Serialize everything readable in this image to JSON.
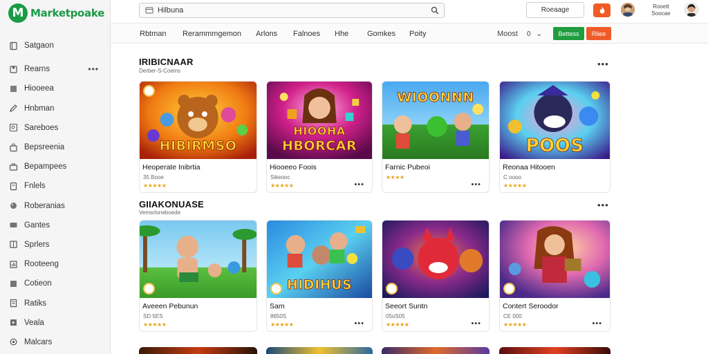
{
  "app": {
    "name": "Marketpoake",
    "logo_letter": "M"
  },
  "sidebar": {
    "items": [
      {
        "label": "Satgaon",
        "icon": "book-icon"
      },
      {
        "label": "Rearns",
        "icon": "bookmark-icon",
        "more": "•••"
      },
      {
        "label": "Hiooeea",
        "icon": "grid-icon"
      },
      {
        "label": "Hnbman",
        "icon": "pencil-icon"
      },
      {
        "label": "Sareboes",
        "icon": "search-icon"
      },
      {
        "label": "Bepsreenia",
        "icon": "bag-icon"
      },
      {
        "label": "Bepampees",
        "icon": "briefcase-icon"
      },
      {
        "label": "Fnlels",
        "icon": "file-icon"
      },
      {
        "label": "Roberanias",
        "icon": "palette-icon"
      },
      {
        "label": "Gantes",
        "icon": "gamepad-icon"
      },
      {
        "label": "Sprlers",
        "icon": "columns-icon"
      },
      {
        "label": "Rooteeng",
        "icon": "chart-icon"
      },
      {
        "label": "Cotieon",
        "icon": "image-icon"
      },
      {
        "label": "Ratiks",
        "icon": "doc-icon"
      },
      {
        "label": "Veala",
        "icon": "video-icon"
      },
      {
        "label": "Malcars",
        "icon": "settings-icon"
      }
    ]
  },
  "header": {
    "search_value": "Hilbuna",
    "button_label": "Roeaage",
    "user_name": "Rooett",
    "user_sub": "Soocae"
  },
  "tabs": [
    {
      "label": "Rbtman"
    },
    {
      "label": "Rerammmgemon"
    },
    {
      "label": "Arlons"
    },
    {
      "label": "Falnoes"
    },
    {
      "label": "Hhe"
    },
    {
      "label": "Gomkes"
    },
    {
      "label": "Poity"
    }
  ],
  "toolbar": {
    "model_label": "Moost",
    "filter_icon_label": "0",
    "green_label": "Bettess",
    "red_label": "Rliee"
  },
  "sections": [
    {
      "title": "IRIBICNAAR",
      "subtitle": "Derber-S-Coeins",
      "more": "•••",
      "cards": [
        {
          "name": "Heoperate Inibrtia",
          "meta": "35 Booe",
          "stars": "★★★★★",
          "thumb_title": "HIBIRMSO",
          "dots": ""
        },
        {
          "name": "Hiooeeo Foois",
          "meta": "Sikeooc",
          "stars": "★★★★★",
          "thumb_title": "HBORCAR",
          "thumb_title2": "HIOOHA",
          "dots": "•••"
        },
        {
          "name": "Farnic Pubeoi",
          "meta": "",
          "stars": "★★★★",
          "thumb_title": "WIOONNN",
          "dots": "•••"
        },
        {
          "name": "Reonaa Hitooen",
          "meta": "C oooo",
          "stars": "★★★★★",
          "thumb_title": "POOS",
          "dots": ""
        }
      ]
    },
    {
      "title": "GIIAKONUASE",
      "subtitle": "Vemsrloneboede",
      "more": "•••",
      "cards": [
        {
          "name": "Aveeen Pebunun",
          "meta": "SD 5ES",
          "stars": "★★★★★",
          "thumb_title": "",
          "dots": ""
        },
        {
          "name": "Sam",
          "meta": "8650S",
          "stars": "★★★★★",
          "thumb_title": "HIDIHUS",
          "dots": "•••"
        },
        {
          "name": "Seeort Suntn",
          "meta": "05oS05",
          "stars": "★★★★★",
          "thumb_title": "",
          "dots": "•••"
        },
        {
          "name": "Contert Seroodor",
          "meta": "CE 000",
          "stars": "★★★★★",
          "thumb_title": "",
          "dots": "•••"
        }
      ]
    }
  ],
  "colors": {
    "brand": "#1b9a45",
    "accent_red": "#ef5b27",
    "star": "#e8a317"
  }
}
